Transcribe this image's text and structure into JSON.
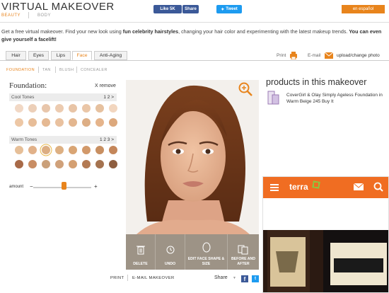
{
  "header": {
    "title": "VIRTUAL MAKEOVER",
    "crumbs": [
      "BEAUTY",
      "BODY"
    ],
    "like_label": "Like 5K",
    "share_label": "Share",
    "tweet_label": "Tweet",
    "language_button": "en español"
  },
  "intro": {
    "part1": "Get a free virtual makeover. Find your new look using ",
    "bold1": "fun celebrity hairstyles",
    "part2": ", changing your hair color and experimenting with the latest makeup trends. ",
    "bold2": "You can even give yourself a facelift!"
  },
  "tabs": [
    "Hair",
    "Eyes",
    "Lips",
    "Face",
    "Anti-Aging"
  ],
  "tab_actions": {
    "print": "Print",
    "email": "E-mail",
    "upload": "upload/change photo"
  },
  "subtabs": [
    "FOUNDATION",
    "TAN",
    "BLUSH",
    "CONCEALER"
  ],
  "foundation": {
    "heading": "Foundation:",
    "remove": "X remove",
    "cool_label": "Cool Tones",
    "cool_pages": "1 2 >",
    "warm_label": "Warm Tones",
    "warm_pages": "1 2 3 >",
    "amount_label": "amount",
    "amount_minus": "−",
    "amount_plus": "+",
    "amount_value": 0.53
  },
  "cool_swatches": [
    "#f1d8c5",
    "#eccfb8",
    "#e8c6ab",
    "#eccbb0",
    "#e8c4a6",
    "#eac6a7",
    "#e6c19f",
    "#f2d6bf",
    "#edc7a5",
    "#e7bd98",
    "#e5b993",
    "#e9c19f",
    "#e3b68f",
    "#ddae85",
    "#e5b48b",
    "#dca87c"
  ],
  "warm_swatches": [
    "#e6bf98",
    "#e1b189",
    "#dcae83",
    "#ddb083",
    "#d9a574",
    "#d2996a",
    "#c88f61",
    "#c4865a",
    "#a86a48",
    "#c98d63",
    "#caa07a",
    "#d0a17a",
    "#d49f71",
    "#b37a53",
    "#a5734f",
    "#8e5e40"
  ],
  "toolbar": [
    "DELETE",
    "UNDO",
    "EDIT FACE SHAPE & SIZE",
    "BEFORE AND AFTER"
  ],
  "products": {
    "heading": "products in this makeover",
    "item": "CoverGirl & Olay Simply Ageless Foundation in Warm Beige 245 Buy It"
  },
  "ad": {
    "brand": "terra"
  },
  "footer": {
    "print": "PRINT",
    "email": "E-MAIL MAKEOVER",
    "share": "Share",
    "fb": "f",
    "tw": "t"
  },
  "colors": {
    "accent": "#e8841c",
    "facebook": "#3b5998",
    "twitter": "#1d9bf0",
    "toolbar": "#9d9386"
  }
}
